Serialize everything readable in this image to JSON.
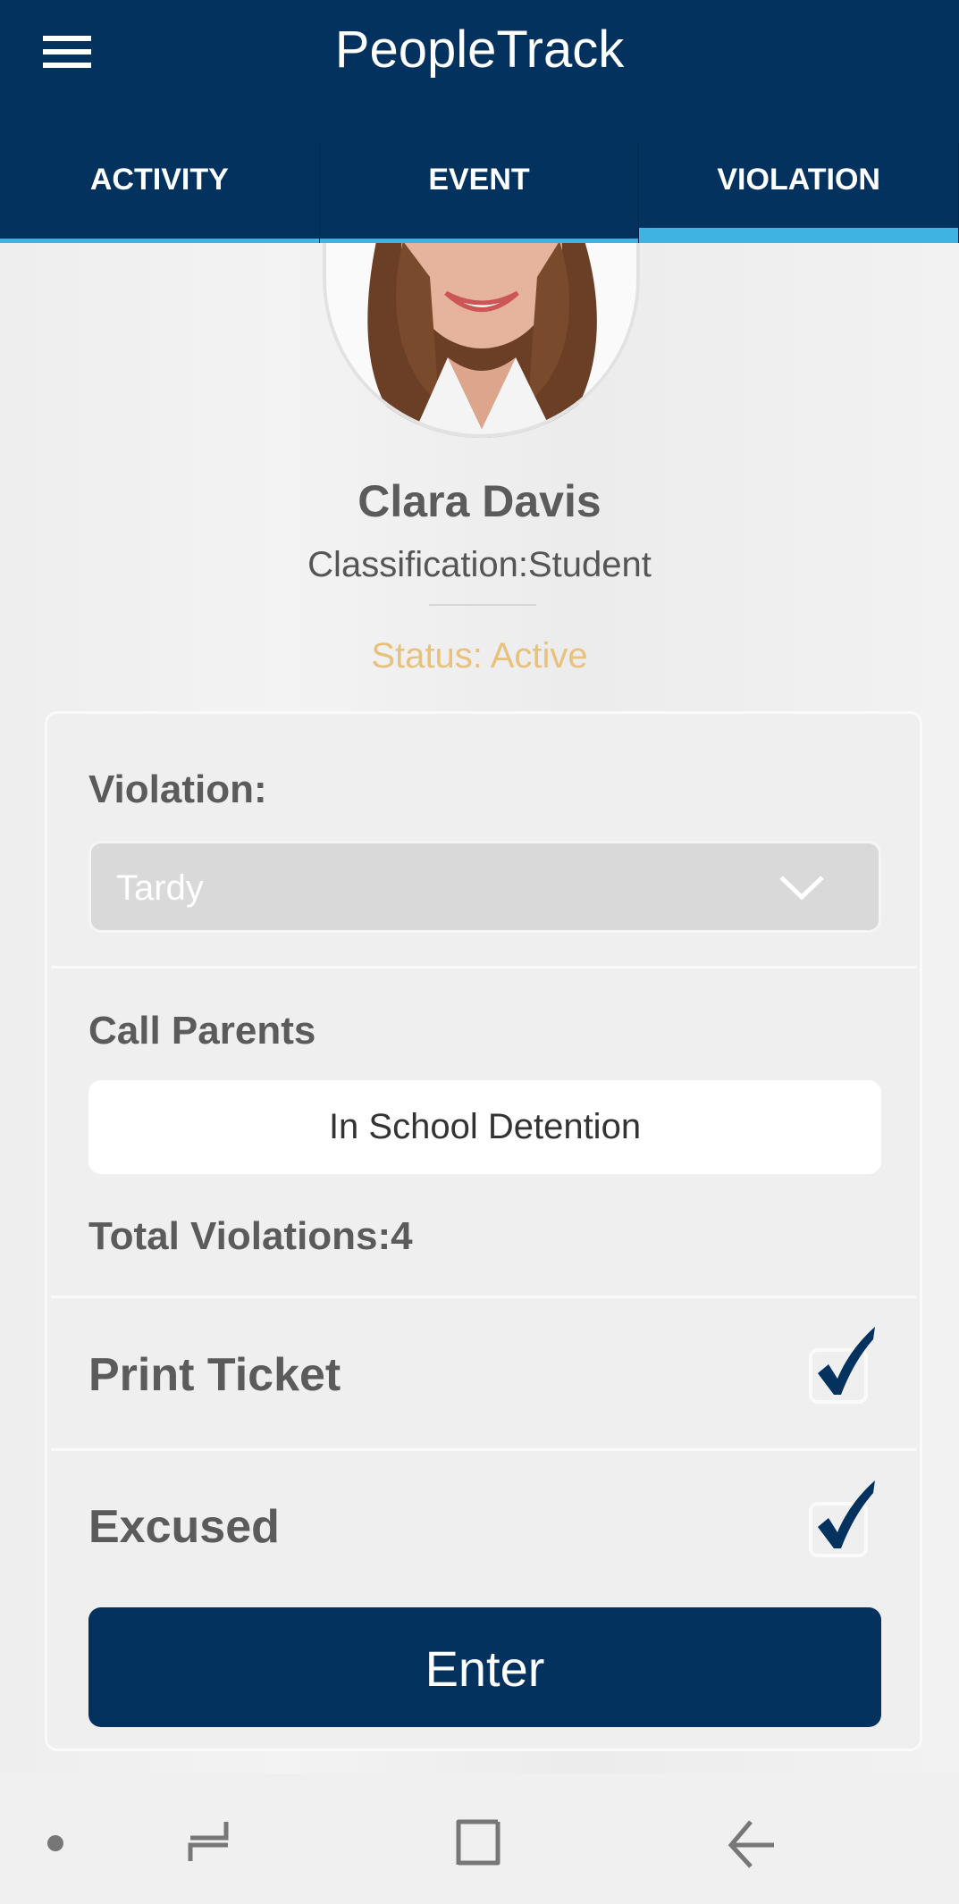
{
  "app": {
    "title": "PeopleTrack",
    "menu_icon": "hamburger-icon"
  },
  "tabs": [
    {
      "label": "ACTIVITY",
      "active": false
    },
    {
      "label": "EVENT",
      "active": false
    },
    {
      "label": "VIOLATION",
      "active": true
    }
  ],
  "profile": {
    "name": "Clara Davis",
    "classification": "Classification:Student",
    "status": "Status: Active",
    "status_color": "#e8c27c"
  },
  "form": {
    "violation_label": "Violation:",
    "violation_value": "Tardy",
    "call_parents_label": "Call Parents",
    "consequence_value": "In School Detention",
    "total_violations": "Total Violations:4",
    "print_ticket": {
      "label": "Print Ticket",
      "checked": true
    },
    "excused": {
      "label": "Excused",
      "checked": true
    },
    "enter_label": "Enter"
  },
  "colors": {
    "primary": "#03325f",
    "accent": "#3fb4e3"
  },
  "system_nav": [
    "dot-icon",
    "recents-icon",
    "home-icon",
    "back-icon"
  ]
}
